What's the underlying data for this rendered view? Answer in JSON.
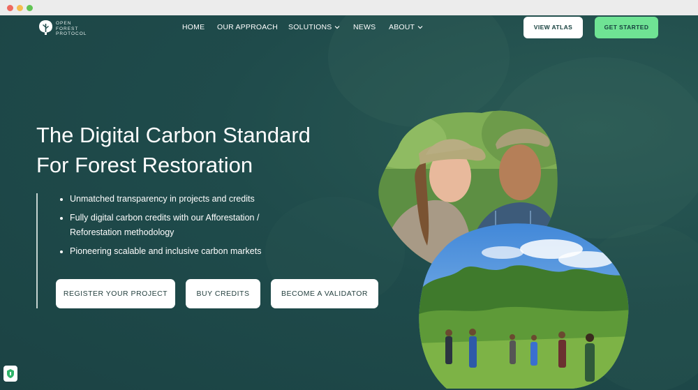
{
  "brand": {
    "line1": "OPEN",
    "line2": "FOREST",
    "line3": "PROTOCOL"
  },
  "nav": {
    "home": "HOME",
    "approach": "OUR APPROACH",
    "solutions": "SOLUTIONS",
    "news": "NEWS",
    "about": "ABOUT"
  },
  "header_buttons": {
    "atlas": "VIEW ATLAS",
    "start": "GET STARTED"
  },
  "hero": {
    "title_line1": "The Digital Carbon Standard",
    "title_line2": "For Forest Restoration",
    "bullets": [
      "Unmatched transparency in projects and credits",
      "Fully digital carbon credits with our Afforestation / Reforestation methodology",
      "Pioneering scalable and inclusive carbon markets"
    ]
  },
  "cta": {
    "register": "REGISTER YOUR PROJECT",
    "buy": "BUY CREDITS",
    "validator": "BECOME A VALIDATOR"
  },
  "icons": {
    "logo": "tree-logo-icon",
    "dropdown": "chevron-down-icon",
    "badge": "shield-badge-icon"
  },
  "colors": {
    "background": "#1f4b4b",
    "accent_green": "#6fe394",
    "button_white": "#ffffff",
    "text_dark": "#16403e"
  }
}
